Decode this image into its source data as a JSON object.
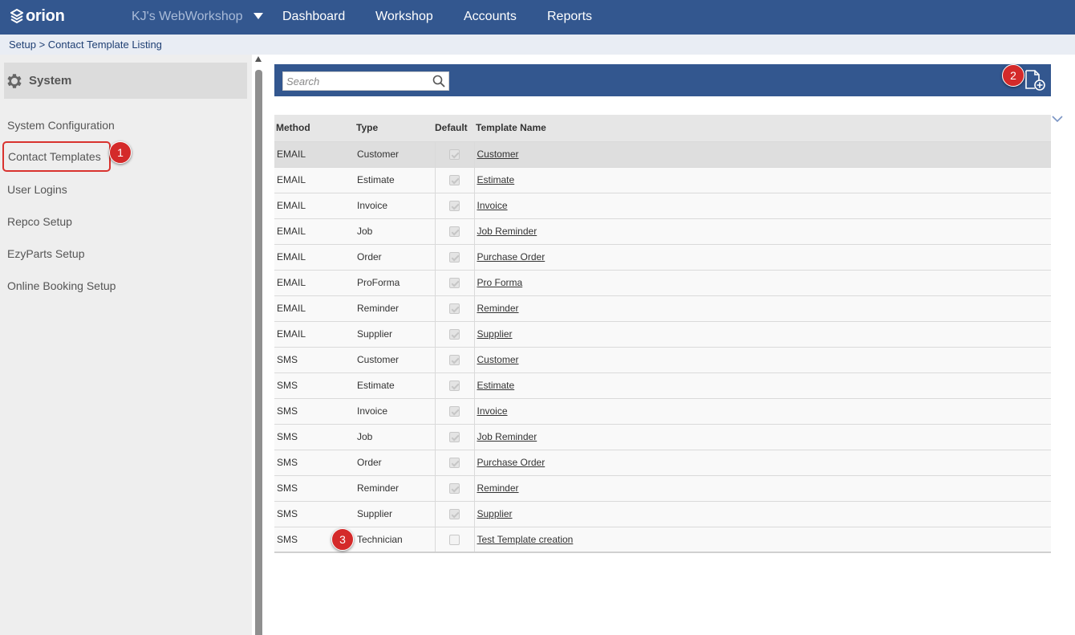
{
  "app": {
    "logo_text": "orion",
    "workshop_name": "KJ's WebWorkshop"
  },
  "nav": {
    "dashboard": "Dashboard",
    "workshop": "Workshop",
    "accounts": "Accounts",
    "reports": "Reports"
  },
  "breadcrumb": "Setup > Contact Template Listing",
  "sidebar": {
    "title": "System",
    "items": [
      {
        "label": "System Configuration"
      },
      {
        "label": "Contact Templates"
      },
      {
        "label": "User Logins"
      },
      {
        "label": "Repco Setup"
      },
      {
        "label": "EzyParts Setup"
      },
      {
        "label": "Online Booking Setup"
      }
    ]
  },
  "search": {
    "placeholder": "Search",
    "value": ""
  },
  "table": {
    "columns": {
      "method": "Method",
      "type": "Type",
      "default": "Default",
      "template_name": "Template Name"
    },
    "rows": [
      {
        "method": "EMAIL",
        "type": "Customer",
        "default": true,
        "template_name": "Customer"
      },
      {
        "method": "EMAIL",
        "type": "Estimate",
        "default": true,
        "template_name": "Estimate"
      },
      {
        "method": "EMAIL",
        "type": "Invoice",
        "default": true,
        "template_name": "Invoice"
      },
      {
        "method": "EMAIL",
        "type": "Job",
        "default": true,
        "template_name": "Job Reminder"
      },
      {
        "method": "EMAIL",
        "type": "Order",
        "default": true,
        "template_name": "Purchase Order"
      },
      {
        "method": "EMAIL",
        "type": "ProForma",
        "default": true,
        "template_name": "Pro Forma"
      },
      {
        "method": "EMAIL",
        "type": "Reminder",
        "default": true,
        "template_name": "Reminder"
      },
      {
        "method": "EMAIL",
        "type": "Supplier",
        "default": true,
        "template_name": "Supplier"
      },
      {
        "method": "SMS",
        "type": "Customer",
        "default": true,
        "template_name": "Customer"
      },
      {
        "method": "SMS",
        "type": "Estimate",
        "default": true,
        "template_name": "Estimate"
      },
      {
        "method": "SMS",
        "type": "Invoice",
        "default": true,
        "template_name": "Invoice"
      },
      {
        "method": "SMS",
        "type": "Job",
        "default": true,
        "template_name": "Job Reminder"
      },
      {
        "method": "SMS",
        "type": "Order",
        "default": true,
        "template_name": "Purchase Order"
      },
      {
        "method": "SMS",
        "type": "Reminder",
        "default": true,
        "template_name": "Reminder"
      },
      {
        "method": "SMS",
        "type": "Supplier",
        "default": true,
        "template_name": "Supplier"
      },
      {
        "method": "SMS",
        "type": "Technician",
        "default": false,
        "template_name": "Test Template creation"
      }
    ]
  },
  "markers": {
    "m1": "1",
    "m2": "2",
    "m3": "3"
  },
  "colors": {
    "nav_blue": "#33578f",
    "marker_red": "#d42a2a"
  },
  "icons": [
    "orion-logo-icon",
    "chevron-down-icon",
    "gear-icon",
    "search-icon",
    "new-document-icon",
    "collapse-chevron-icon"
  ]
}
